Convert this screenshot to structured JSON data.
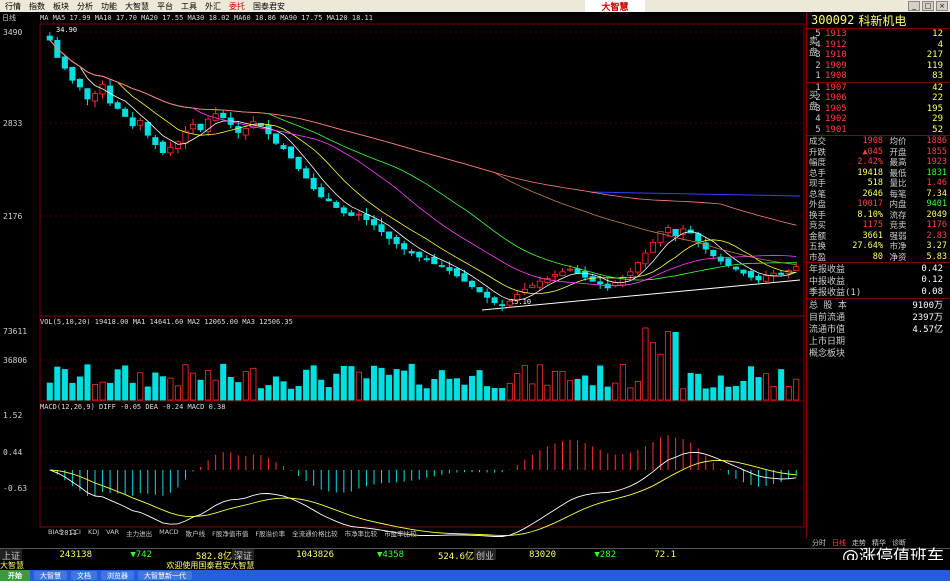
{
  "menu": [
    {
      "label": "行情"
    },
    {
      "label": "指数"
    },
    {
      "label": "板块"
    },
    {
      "label": "分析"
    },
    {
      "label": "功能"
    },
    {
      "label": "大智慧"
    },
    {
      "label": "平台"
    },
    {
      "label": "工具"
    },
    {
      "label": "外汇"
    },
    {
      "label": "委托",
      "active": true
    },
    {
      "label": "国泰君安"
    }
  ],
  "logo": "大智慧",
  "chart_header": {
    "period": "日线",
    "ma_legend": "MA MA5 17.99 MA10 17.70 MA20 17.55 MA30 18.02 MA60 18.86 MA90 17.75 MA120 18.11",
    "vol_legend": "VOL(5,10,20)  19418.00  MA1 14641.60  MA2 12065.00  MA3 12506.35",
    "macd_legend": "MACD(12,26,9)  DIFF -0.05  DEA -0.24  MACD 0.38",
    "year_label": "2011"
  },
  "chart_data": {
    "type": "candlestick",
    "price_axis": {
      "ticks": [
        "3490",
        "2833",
        "2176"
      ],
      "range": [
        1460,
        3550
      ]
    },
    "annotations": {
      "high": "34.90",
      "low": "15.10"
    },
    "volume_axis": {
      "ticks": [
        "73611",
        "36806"
      ]
    },
    "macd_axis": {
      "ticks": [
        "1.52",
        "0.44",
        "-0.63"
      ]
    },
    "close_series": [
      34.9,
      33.6,
      32.8,
      31.9,
      31.4,
      30.5,
      30.9,
      31.6,
      30.2,
      29.8,
      29.2,
      28.5,
      28.9,
      27.8,
      27.1,
      26.5,
      26.9,
      27.3,
      28.1,
      28.6,
      28.2,
      29.0,
      29.4,
      29.1,
      28.6,
      28.0,
      28.3,
      28.8,
      28.5,
      27.9,
      27.2,
      26.8,
      26.1,
      25.3,
      24.6,
      23.8,
      23.2,
      22.9,
      22.4,
      22.0,
      21.8,
      21.9,
      21.5,
      21.1,
      20.6,
      20.1,
      19.7,
      19.3,
      19.0,
      18.7,
      18.5,
      18.2,
      18.0,
      17.7,
      17.3,
      16.9,
      16.5,
      16.1,
      15.7,
      15.3,
      15.1,
      15.4,
      15.9,
      16.3,
      16.6,
      16.9,
      17.1,
      17.4,
      17.6,
      17.8,
      17.5,
      17.2,
      16.9,
      16.7,
      16.4,
      16.8,
      17.2,
      17.6,
      18.3,
      19.0,
      19.8,
      20.6,
      20.9,
      20.3,
      20.8,
      20.5,
      19.9,
      19.3,
      18.8,
      18.4,
      18.1,
      17.8,
      17.5,
      17.2,
      17.0,
      17.3,
      17.5,
      17.4,
      17.7,
      17.99
    ]
  },
  "bottom_tabs": [
    {
      "label": "BIAS"
    },
    {
      "label": "CCI"
    },
    {
      "label": "KDJ"
    },
    {
      "label": "VAR"
    },
    {
      "label": "主力进出"
    },
    {
      "label": "MACD"
    },
    {
      "label": "散户线"
    },
    {
      "label": "F股净值市值"
    },
    {
      "label": "F股溢价率"
    },
    {
      "label": "全流通价格比较"
    },
    {
      "label": "市净率比较"
    },
    {
      "label": "市盈率比较"
    }
  ],
  "stock": {
    "code": "300092",
    "name": "科新机电"
  },
  "order_book": {
    "sell_label": "卖盘",
    "buy_label": "买盘",
    "asks": [
      {
        "level": "5",
        "price": "1913",
        "vol": "12"
      },
      {
        "level": "4",
        "price": "1912",
        "vol": "4"
      },
      {
        "level": "3",
        "price": "1910",
        "vol": "217"
      },
      {
        "level": "2",
        "price": "1909",
        "vol": "119"
      },
      {
        "level": "1",
        "price": "1908",
        "vol": "83"
      }
    ],
    "bids": [
      {
        "level": "1",
        "price": "1907",
        "vol": "42"
      },
      {
        "level": "2",
        "price": "1906",
        "vol": "22"
      },
      {
        "level": "3",
        "price": "1905",
        "vol": "195"
      },
      {
        "level": "4",
        "price": "1902",
        "vol": "29"
      },
      {
        "level": "5",
        "price": "1901",
        "vol": "52"
      }
    ]
  },
  "quote": [
    {
      "l1": "成交",
      "v1": "1908",
      "l2": "均价",
      "v2": "1886",
      "c1": "#ff4040",
      "c2": "#ff4040"
    },
    {
      "l1": "升跌",
      "v1": "▲045",
      "l2": "开盘",
      "v2": "1855",
      "c1": "#ff4040",
      "c2": "#ff4040"
    },
    {
      "l1": "幅度",
      "v1": "2.42%",
      "l2": "最高",
      "v2": "1923",
      "c1": "#ff4040",
      "c2": "#ff4040"
    },
    {
      "l1": "总手",
      "v1": "19418",
      "l2": "最低",
      "v2": "1831",
      "c1": "#ffff66",
      "c2": "#33ff33"
    },
    {
      "l1": "现手",
      "v1": "518",
      "l2": "量比",
      "v2": "1.46",
      "c1": "#ffff66",
      "c2": "#ff4040"
    },
    {
      "l1": "总笔",
      "v1": "2646",
      "l2": "每笔",
      "v2": "7.34",
      "c1": "#ffff66",
      "c2": "#ffff66"
    },
    {
      "l1": "外盘",
      "v1": "10017",
      "l2": "内盘",
      "v2": "9401",
      "c1": "#ff4040",
      "c2": "#33ff33"
    },
    {
      "l1": "换手",
      "v1": "8.10%",
      "l2": "流存",
      "v2": "2049",
      "c1": "#ffff66",
      "c2": "#ffff66"
    },
    {
      "l1": "竞买",
      "v1": "1175",
      "l2": "竞卖",
      "v2": "1176",
      "c1": "#ff4040",
      "c2": "#ff4040"
    },
    {
      "l1": "金额",
      "v1": "3661",
      "l2": "强弱",
      "v2": "2.83",
      "c1": "#ffff66",
      "c2": "#ff4040"
    },
    {
      "l1": "五换",
      "v1": "27.64%",
      "l2": "市净",
      "v2": "3.27",
      "c1": "#ffff66",
      "c2": "#ffff66"
    },
    {
      "l1": "市盈",
      "v1": "80",
      "l2": "净资",
      "v2": "5.83",
      "c1": "#ffff66",
      "c2": "#ffff66"
    }
  ],
  "financials": [
    {
      "label": "年报收益",
      "value": "0.42"
    },
    {
      "label": "中报收益",
      "value": "0.12"
    },
    {
      "label": "季报收益(1)",
      "value": "0.08"
    }
  ],
  "info": [
    {
      "label": "总 股 本",
      "value": "9100万"
    },
    {
      "label": "目前流通",
      "value": "2397万"
    },
    {
      "label": "流通市值",
      "value": "4.57亿"
    },
    {
      "label": "上市日期",
      "value": ""
    },
    {
      "label": "概念板块",
      "value": ""
    }
  ],
  "side_tabs": [
    {
      "label": "分时"
    },
    {
      "label": "日线",
      "on": true
    },
    {
      "label": "走势"
    },
    {
      "label": "精华"
    },
    {
      "label": "诊断"
    }
  ],
  "ticker": {
    "sh_name": "上证",
    "sh_vol": "243138",
    "sh_chg": "▼742",
    "sh_amt": "582.8亿",
    "sz_name": "深证",
    "sz_vol": "1043826",
    "sz_chg": "▼4358",
    "sz_amt": "524.6亿",
    "ind_name": "创业",
    "ind_vol": "83020",
    "ind_chg": "▼282",
    "ind_amt": "72.1"
  },
  "scroll_message": "大智慧                                                        欢迎使用国泰君安大智慧",
  "watermark": "@涨停值班车",
  "taskbar": {
    "start": "开始",
    "tasks": [
      {
        "label": "大智慧"
      },
      {
        "label": "文档"
      },
      {
        "label": "浏览器"
      },
      {
        "label": "大智慧新一代"
      }
    ]
  }
}
